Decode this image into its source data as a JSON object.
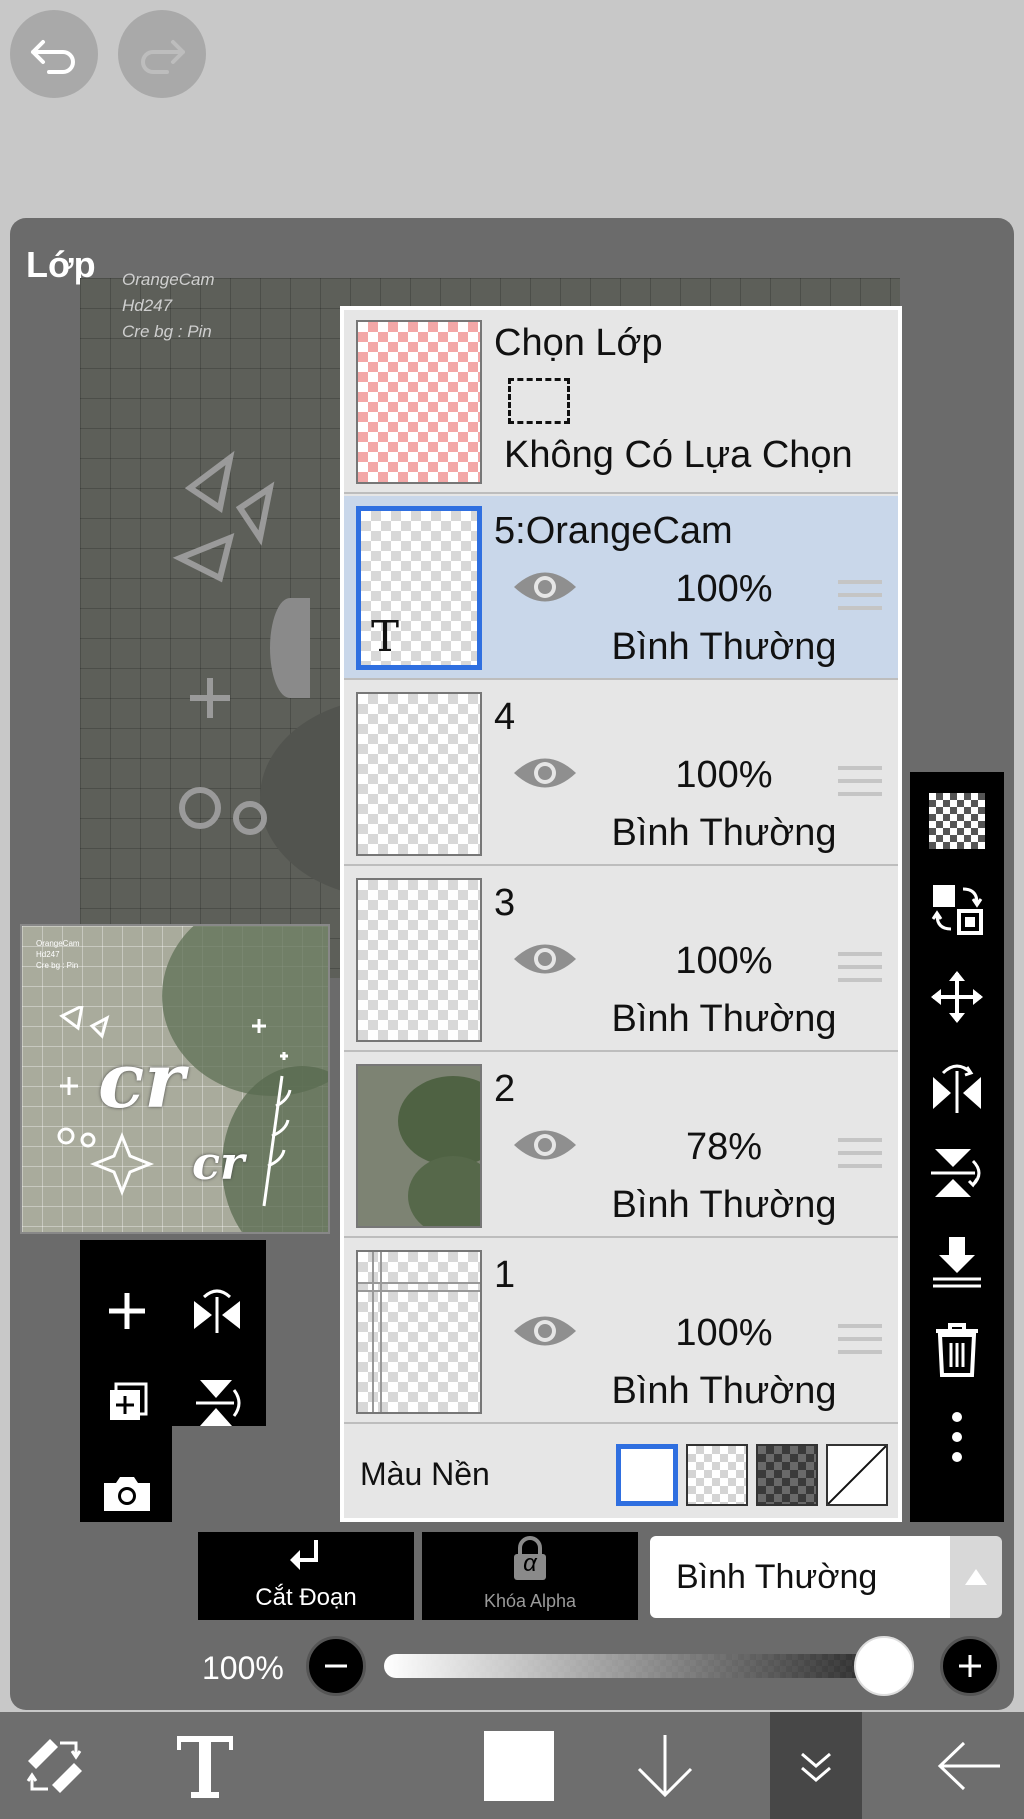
{
  "panel": {
    "title": "Lớp"
  },
  "canvas": {
    "watermark": [
      "OrangeCam",
      "Hd247",
      "Cre bg : Pin"
    ],
    "thumb_text": [
      "cr",
      "cr"
    ]
  },
  "selection_row": {
    "title": "Chọn Lớp",
    "status": "Không Có Lựa Chọn"
  },
  "layers": [
    {
      "name": "5:OrangeCam",
      "opacity": "100%",
      "blend": "Bình Thường",
      "selected": true,
      "type": "text",
      "thumb_glyph": "T"
    },
    {
      "name": "4",
      "opacity": "100%",
      "blend": "Bình Thường",
      "selected": false
    },
    {
      "name": "3",
      "opacity": "100%",
      "blend": "Bình Thường",
      "selected": false
    },
    {
      "name": "2",
      "opacity": "78%",
      "blend": "Bình Thường",
      "selected": false
    },
    {
      "name": "1",
      "opacity": "100%",
      "blend": "Bình Thường",
      "selected": false
    }
  ],
  "background_color": {
    "label": "Màu Nền",
    "options": [
      "white",
      "light-checker",
      "dark-checker",
      "none"
    ],
    "selected": "white"
  },
  "actions": {
    "clip_label": "Cắt Đoạn",
    "alpha_lock_label": "Khóa Alpha",
    "alpha_glyph": "α"
  },
  "blend_mode": {
    "value": "Bình Thường"
  },
  "opacity": {
    "label": "100%",
    "value": 1.0
  },
  "colors": {
    "accent": "#2f6fe0",
    "selected_row": "#c9d7ea",
    "panel": "#6b6b6b"
  }
}
